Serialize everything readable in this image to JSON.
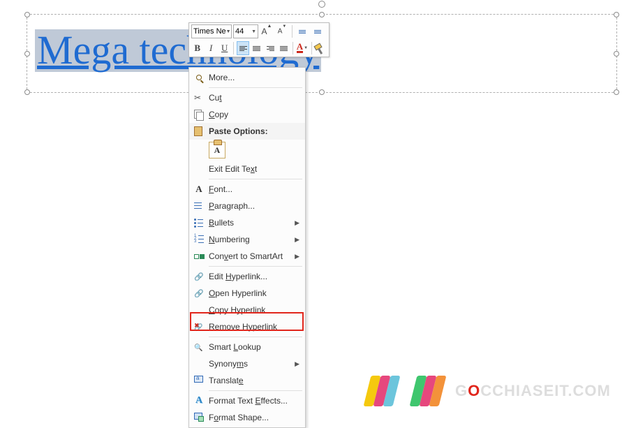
{
  "textbox": {
    "text": "Mega technology"
  },
  "mini_toolbar": {
    "font_name": "Times Ne",
    "font_size": "44",
    "grow": "A",
    "shrink": "A",
    "bold": "B",
    "italic": "I",
    "underline": "U",
    "fontcolor": "A"
  },
  "context_menu": {
    "more": {
      "label": "More...",
      "u": ""
    },
    "cut": {
      "pre": "Cu",
      "u": "t",
      "post": ""
    },
    "copy": {
      "pre": "",
      "u": "C",
      "post": "opy"
    },
    "paste_header": "Paste Options:",
    "paste_keep_text": "A",
    "exit_edit": {
      "pre": "Exit Edit Te",
      "u": "x",
      "post": "t"
    },
    "font": {
      "pre": "",
      "u": "F",
      "post": "ont..."
    },
    "paragraph": {
      "pre": "",
      "u": "P",
      "post": "aragraph..."
    },
    "bullets": {
      "pre": "",
      "u": "B",
      "post": "ullets"
    },
    "numbering": {
      "pre": "",
      "u": "N",
      "post": "umbering"
    },
    "smartart": {
      "pre": "Con",
      "u": "v",
      "post": "ert to SmartArt"
    },
    "edit_hyperlink": {
      "pre": "Edit ",
      "u": "H",
      "post": "yperlink..."
    },
    "open_hyperlink": {
      "pre": "",
      "u": "O",
      "post": "pen Hyperlink"
    },
    "copy_hyperlink": {
      "pre": "",
      "u": "C",
      "post": "opy Hyperlink"
    },
    "remove_hyperlink": {
      "pre": "Re",
      "u": "m",
      "post": "ove Hyperlink"
    },
    "smart_lookup": {
      "pre": "Smart ",
      "u": "L",
      "post": "ookup"
    },
    "synonyms": {
      "pre": "Synony",
      "u": "m",
      "post": "s"
    },
    "translate": {
      "pre": "Translat",
      "u": "e",
      "post": ""
    },
    "text_effects": {
      "pre": "Format Text ",
      "u": "E",
      "post": "ffects..."
    },
    "format_shape": {
      "pre": "F",
      "u": "o",
      "post": "rmat Shape..."
    }
  },
  "watermark": {
    "text_pre": "G",
    "text_accent": "O",
    "text_post": "CCHIASEIT.COM"
  }
}
